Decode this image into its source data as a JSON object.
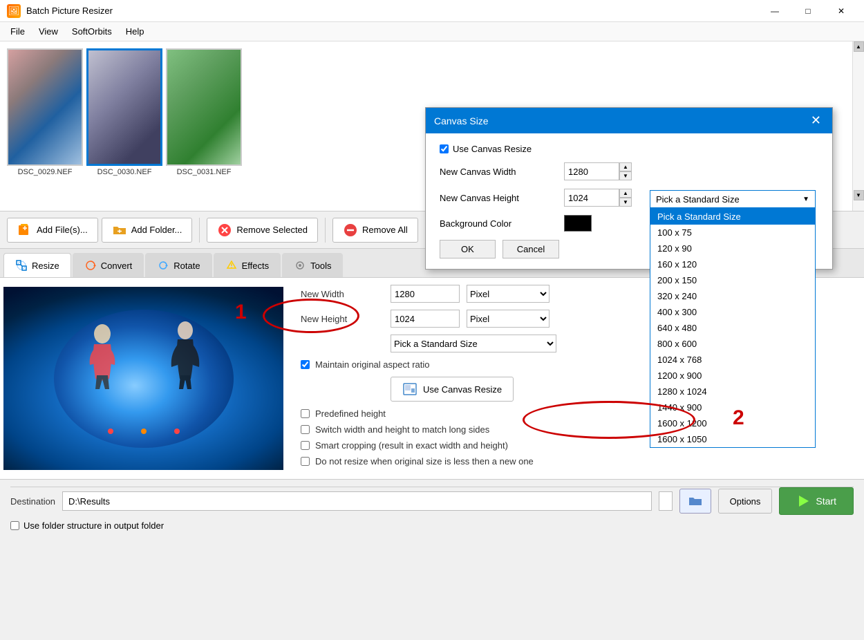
{
  "titleBar": {
    "icon": "🖼",
    "title": "Batch Picture Resizer",
    "minimize": "—",
    "maximize": "□",
    "close": "✕"
  },
  "menu": {
    "items": [
      "File",
      "View",
      "SoftOrbits",
      "Help"
    ]
  },
  "thumbnails": [
    {
      "label": "DSC_0029.NEF",
      "class": "thumb-img-1",
      "selected": false
    },
    {
      "label": "DSC_0030.NEF",
      "class": "thumb-img-2",
      "selected": true
    },
    {
      "label": "DSC_0031.NEF",
      "class": "thumb-img-3",
      "selected": false
    }
  ],
  "toolbar": {
    "addFiles": "Add File(s)...",
    "addFolder": "Add Folder...",
    "removeSelected": "Remove Selected",
    "removeAll": "Remove All"
  },
  "tabs": [
    {
      "label": "Resize",
      "active": true
    },
    {
      "label": "Convert",
      "active": false
    },
    {
      "label": "Rotate",
      "active": false
    },
    {
      "label": "Effects",
      "active": false
    },
    {
      "label": "Tools",
      "active": false
    }
  ],
  "resizePanel": {
    "widthLabel": "New Width",
    "widthValue": "1280",
    "widthUnit": "Pixel",
    "heightLabel": "New Height",
    "heightValue": "1024",
    "heightUnit": "Pixel",
    "maintainAspect": true,
    "maintainAspectLabel": "Maintain original aspect ratio",
    "predefinedHeight": false,
    "predefinedHeightLabel": "Predefined height",
    "switchWidthHeight": false,
    "switchWidthHeightLabel": "Switch width and height to match long sides",
    "smartCropping": false,
    "smartCroppingLabel": "Smart cropping (result in exact width and height)",
    "doNotResize": false,
    "doNotResizeLabel": "Do not resize when original size is less then a new one",
    "canvasBtnLabel": "Use Canvas Resize",
    "standardSize": "Pick a Standard Size"
  },
  "dialog": {
    "title": "Canvas Size",
    "useCanvasResize": true,
    "useCanvasResizeLabel": "Use Canvas Resize",
    "widthLabel": "New Canvas Width",
    "widthValue": "1280",
    "heightLabel": "New Canvas Height",
    "heightValue": "1024",
    "bgColorLabel": "Background Color",
    "okBtn": "OK",
    "cancelBtn": "Cancel"
  },
  "dropdown": {
    "placeholder": "Pick a Standard Size",
    "selected": "Pick a Standard Size",
    "items": [
      "Pick a Standard Size",
      "100 x 75",
      "120 x 90",
      "160 x 120",
      "200 x 150",
      "320 x 240",
      "400 x 300",
      "640 x 480",
      "800 x 600",
      "1024 x 768",
      "1200 x 900",
      "1280 x 1024",
      "1440 x 900",
      "1600 x 1200",
      "1600 x 1050"
    ]
  },
  "bottomBar": {
    "destinationLabel": "Destination",
    "destinationValue": "D:\\Results",
    "optionsLabel": "Options",
    "startLabel": "Start",
    "folderStructureLabel": "Use folder structure in output folder"
  },
  "annotations": {
    "num1": "1",
    "num2": "2"
  }
}
